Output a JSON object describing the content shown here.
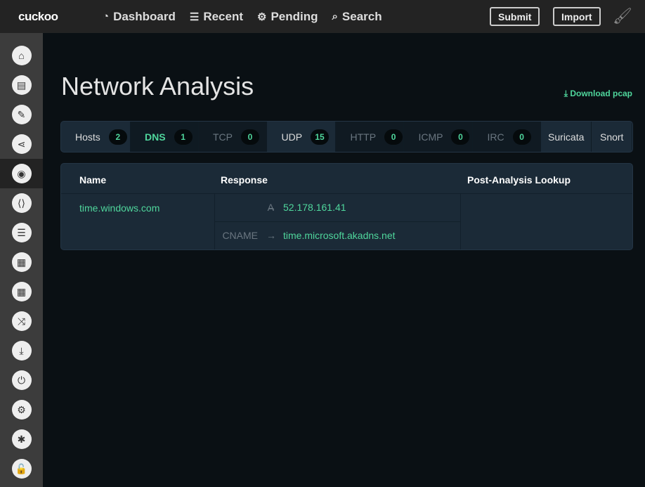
{
  "header": {
    "logo": "cuckoo",
    "nav": [
      {
        "icon": "dashboard-icon",
        "label": "Dashboard"
      },
      {
        "icon": "list-icon",
        "label": "Recent"
      },
      {
        "icon": "cogs-icon",
        "label": "Pending"
      },
      {
        "icon": "search-icon",
        "label": "Search"
      }
    ],
    "submit": "Submit",
    "import": "Import",
    "theme_icon": "paintbrush-icon"
  },
  "sidebar": {
    "items": [
      {
        "icon": "home-icon",
        "glyph": "⌂"
      },
      {
        "icon": "book-icon",
        "glyph": "▤"
      },
      {
        "icon": "pencil-icon",
        "glyph": "✎"
      },
      {
        "icon": "share-icon",
        "glyph": "⋖"
      },
      {
        "icon": "globe-icon",
        "glyph": "◉",
        "active": true
      },
      {
        "icon": "file-code-icon",
        "glyph": "⟨⟩"
      },
      {
        "icon": "server-icon",
        "glyph": "☰"
      },
      {
        "icon": "qrcode-icon",
        "glyph": "▦"
      },
      {
        "icon": "qrcode-icon",
        "glyph": "▦"
      },
      {
        "icon": "random-icon",
        "glyph": "⤨"
      },
      {
        "icon": "download-icon",
        "glyph": "⤓"
      },
      {
        "icon": "power-icon",
        "glyph": "⏻"
      },
      {
        "icon": "cogs-icon",
        "glyph": "⚙"
      },
      {
        "icon": "bug-icon",
        "glyph": "✱"
      },
      {
        "icon": "unlock-icon",
        "glyph": "🔓"
      }
    ]
  },
  "page": {
    "title": "Network Analysis",
    "download": "⤓ Download pcap"
  },
  "tabs": [
    {
      "label": "Hosts",
      "count": "2",
      "state": "normal"
    },
    {
      "label": "DNS",
      "count": "1",
      "state": "active"
    },
    {
      "label": "TCP",
      "count": "0",
      "state": "disabled"
    },
    {
      "label": "UDP",
      "count": "15",
      "state": "normal"
    },
    {
      "label": "HTTP",
      "count": "0",
      "state": "disabled"
    },
    {
      "label": "ICMP",
      "count": "0",
      "state": "disabled"
    },
    {
      "label": "IRC",
      "count": "0",
      "state": "disabled"
    },
    {
      "label": "Suricata",
      "state": "normal"
    },
    {
      "label": "Snort",
      "state": "normal"
    }
  ],
  "table": {
    "headers": [
      "Name",
      "Response",
      "Post-Analysis Lookup"
    ],
    "rows": [
      {
        "name": "time.windows.com",
        "responses": [
          {
            "type": "A",
            "arrow": "→",
            "value": "52.178.161.41"
          },
          {
            "type": "CNAME",
            "arrow": "→",
            "value": "time.microsoft.akadns.net"
          }
        ]
      }
    ]
  },
  "colors": {
    "accent": "#4fd69c",
    "background": "#0a1014",
    "panel": "#1b2a37"
  }
}
